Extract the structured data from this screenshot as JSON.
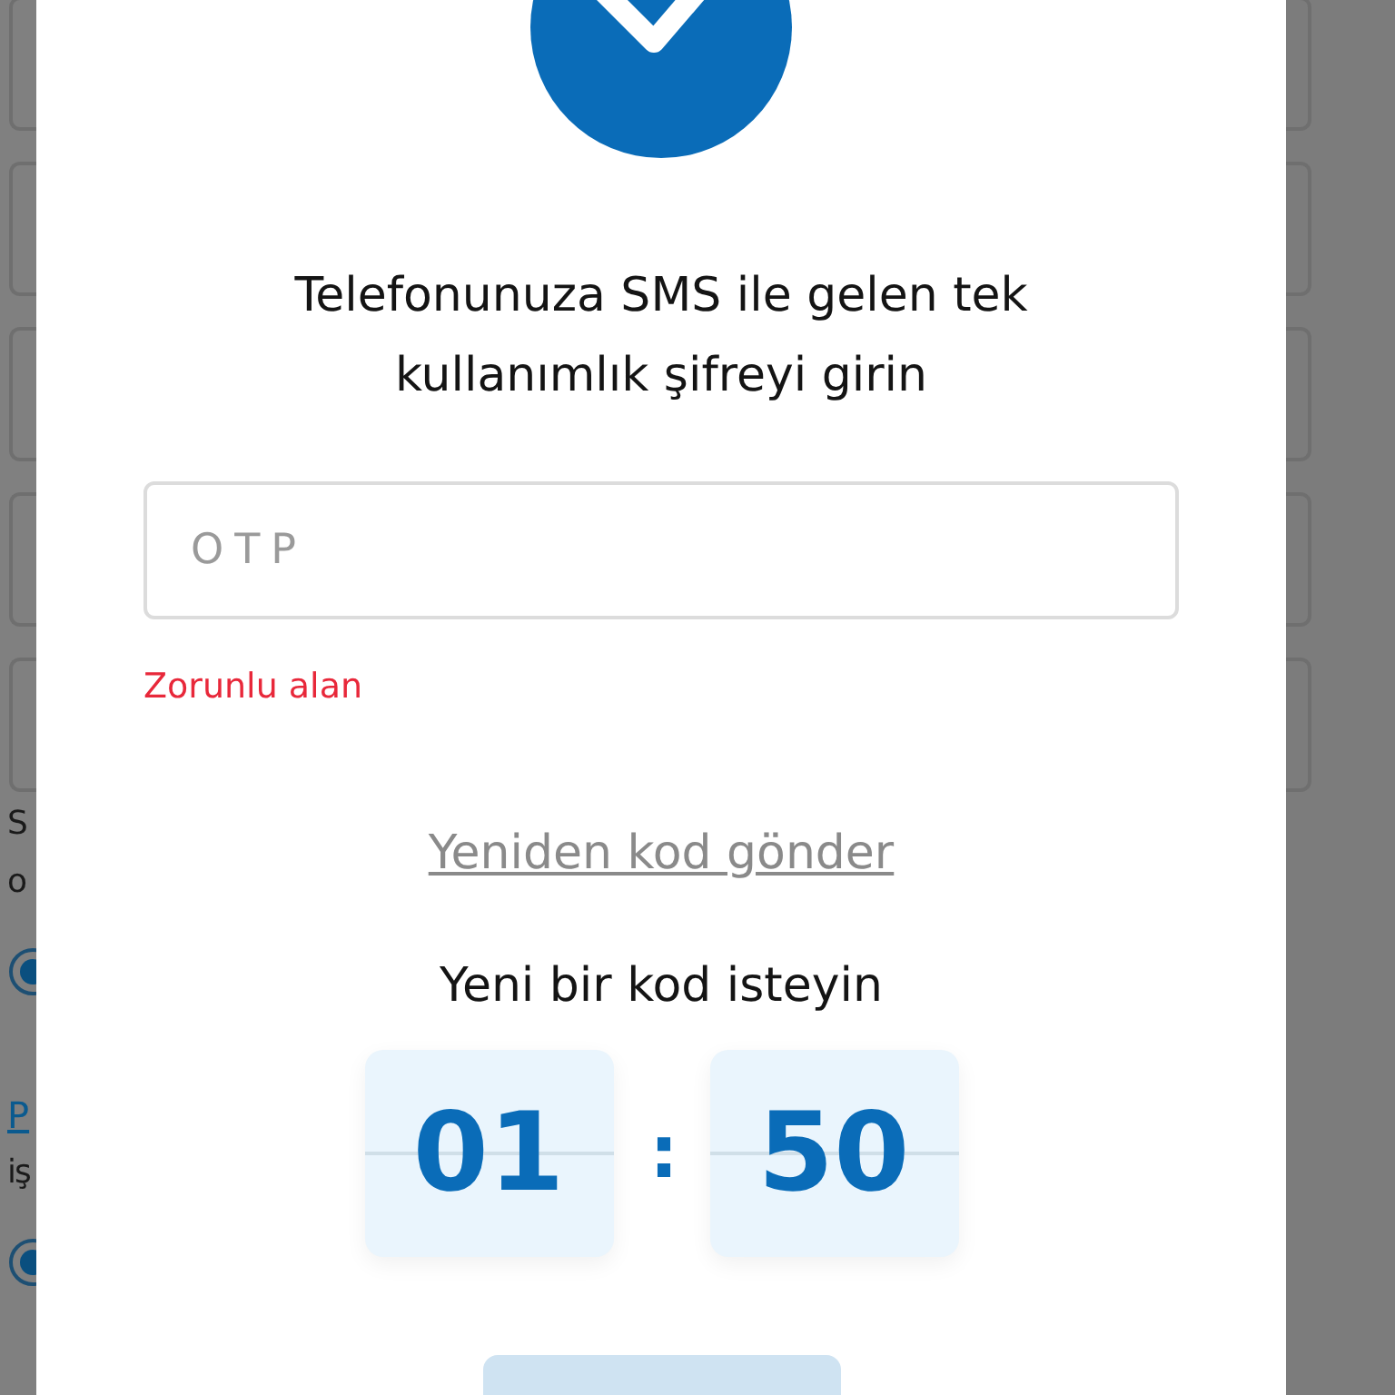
{
  "background": {
    "items": [
      {
        "kind": "text",
        "text": "S"
      },
      {
        "kind": "text",
        "text": "o"
      },
      {
        "kind": "radio",
        "selected": true
      },
      {
        "kind": "link",
        "text": "P"
      },
      {
        "kind": "text",
        "text": "iş"
      },
      {
        "kind": "radio",
        "selected": true
      }
    ]
  },
  "dialog": {
    "message": "Telefonunuza SMS ile gelen tek kullanımlık şifreyi girin",
    "otp_field": {
      "placeholder": "OTP"
    },
    "error": "Zorunlu alan",
    "resend_link": "Yeniden kod gönder",
    "countdown_label": "Yeni bir kod isteyin",
    "timer": {
      "minutes": "01",
      "separator": ":",
      "seconds": "50"
    }
  }
}
